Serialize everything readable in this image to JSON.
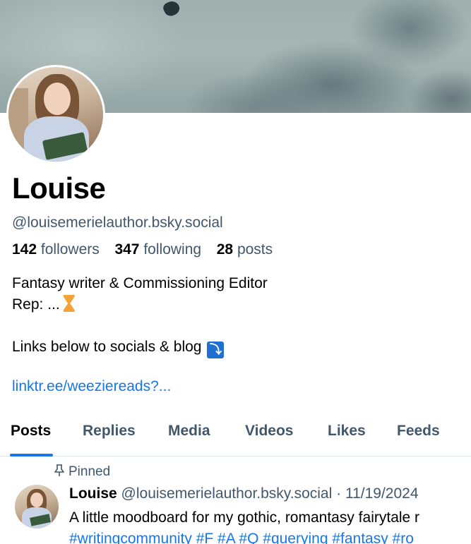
{
  "profile": {
    "display_name": "Louise",
    "handle": "@louisemerielauthor.bsky.social",
    "followers_count": "142",
    "followers_label": "followers",
    "following_count": "347",
    "following_label": "following",
    "posts_count": "28",
    "posts_label": "posts",
    "bio_line1": "Fantasy writer & Commissioning Editor",
    "bio_line2": "Rep: ...",
    "bio_line3": "Links below to socials & blog",
    "down_arrow": "⤵",
    "link": "linktr.ee/weeziereads?..."
  },
  "tabs": [
    {
      "label": "Posts",
      "active": true
    },
    {
      "label": "Replies"
    },
    {
      "label": "Media"
    },
    {
      "label": "Videos"
    },
    {
      "label": "Likes"
    },
    {
      "label": "Feeds"
    }
  ],
  "post": {
    "pinned_label": "Pinned",
    "author": "Louise",
    "handle": "@louisemerielauthor.bsky.social",
    "separator": "·",
    "date": "11/19/2024",
    "text": "A little moodboard for my gothic, romantasy fairytale r",
    "tags": "#writingcommunity #F #A #Q #querying #fantasy #ro"
  },
  "colors": {
    "accent": "#1677e8",
    "muted_text": "#42576c"
  }
}
